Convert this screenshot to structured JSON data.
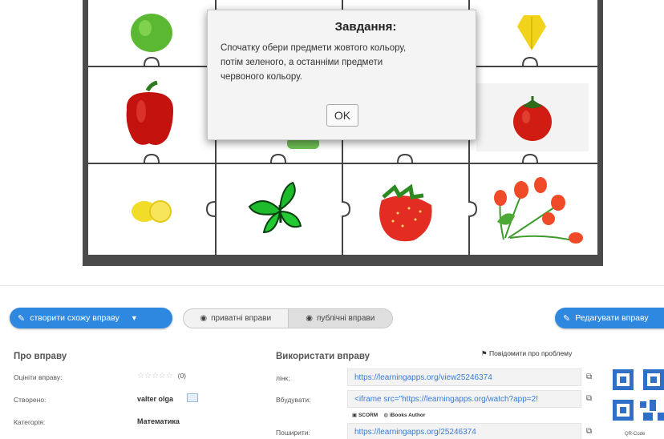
{
  "modal": {
    "title": "Завдання:",
    "text": "Спочатку обери предмети жовтого кольору, потім зеленого, а останніми предмети червоного кольору.",
    "ok": "OK"
  },
  "toolbar": {
    "create_label": "створити схожу вправу",
    "private_label": "приватні вправи",
    "public_label": "публічні вправи",
    "edit_label": "Редагувати вправу"
  },
  "about": {
    "title": "Про вправу",
    "rate_label": "Оцініти вправу:",
    "rating_count": "(0)",
    "created_label": "Створено:",
    "created_value": "valter olga",
    "category_label": "Категорія:",
    "category_value": "Математика"
  },
  "use": {
    "title": "Використати вправу",
    "report": "Повідомити про проблему",
    "link_label": "лінк:",
    "link_value": "https://learningapps.org/view25246374",
    "embed_label": "Вбудувати:",
    "embed_value": "<iframe src=\"https://learningapps.org/watch?app=2!",
    "scorm_label": "SCORM",
    "ibooks_label": "iBooks Author",
    "share_label": "Поширити:",
    "share_value": "https://learningapps.org/25246374",
    "qr_label": "QR-Code"
  },
  "colors": {
    "accent": "#2f88e0",
    "link": "#3a7bd5",
    "board_frame": "#4a4a4a"
  }
}
